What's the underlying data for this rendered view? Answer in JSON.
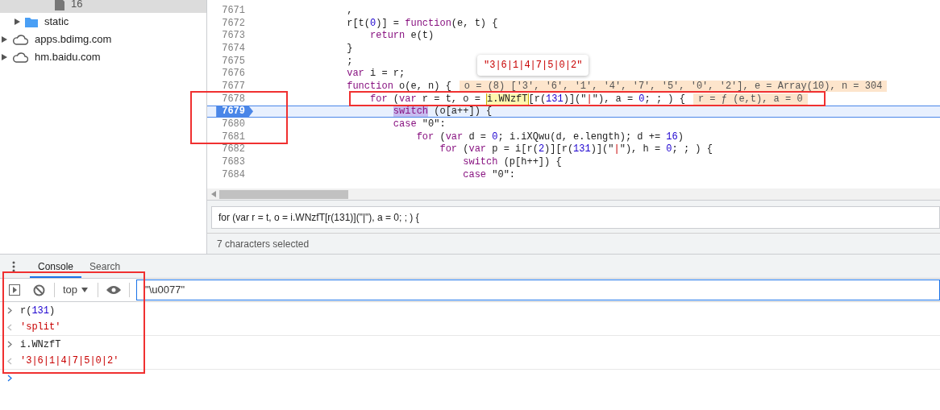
{
  "sidebar": {
    "tree": [
      {
        "kind": "group",
        "children": [
          {
            "kind": "group",
            "children": [
              {
                "label": "16",
                "kind": "file",
                "selected": true
              }
            ]
          },
          {
            "label": "static",
            "kind": "folder",
            "expanded": false,
            "selected": false
          }
        ]
      },
      {
        "label": "apps.bdimg.com",
        "kind": "domain",
        "expanded": false,
        "selected": false
      },
      {
        "label": "hm.baidu.com",
        "kind": "domain",
        "expanded": false,
        "selected": false
      }
    ]
  },
  "editor": {
    "lines": [
      {
        "number": "7671",
        "current": false,
        "tokens": [
          {
            "text": "                ,",
            "kind": "plain"
          }
        ]
      },
      {
        "number": "7672",
        "current": false,
        "tokens": [
          {
            "text": "                r[t(",
            "kind": "plain"
          },
          {
            "text": "0",
            "kind": "num"
          },
          {
            "text": ")] = ",
            "kind": "plain"
          },
          {
            "text": "function",
            "kind": "kw"
          },
          {
            "text": "(e, t) {",
            "kind": "plain"
          }
        ]
      },
      {
        "number": "7673",
        "current": false,
        "tokens": [
          {
            "text": "                    return",
            "kind": "kw"
          },
          {
            "text": " e(t)",
            "kind": "plain"
          }
        ]
      },
      {
        "number": "7674",
        "current": false,
        "tokens": [
          {
            "text": "                }",
            "kind": "plain"
          }
        ]
      },
      {
        "number": "7675",
        "current": false,
        "tokens": [
          {
            "text": "                ;",
            "kind": "plain"
          }
        ]
      },
      {
        "number": "7676",
        "current": false,
        "tokens": [
          {
            "text": "                var",
            "kind": "kw"
          },
          {
            "text": " i = r;",
            "kind": "plain"
          }
        ]
      },
      {
        "number": "7677",
        "current": false,
        "tokens": [
          {
            "text": "                function",
            "kind": "kw"
          },
          {
            "text": " o(e, n) {",
            "kind": "plain"
          }
        ],
        "inline_value": "o = (8) ['3', '6', '1', '4', '7', '5', '0', '2'], e = Array(10), n = 304"
      },
      {
        "number": "7678",
        "current": false,
        "tokens": [
          {
            "text": "                    for",
            "kind": "kw"
          },
          {
            "text": " (",
            "kind": "plain"
          },
          {
            "text": "var",
            "kind": "kw"
          },
          {
            "text": " r = t, o = ",
            "kind": "plain"
          },
          {
            "text": "i.WNzfT",
            "kind": "hover"
          },
          {
            "text": "[r(",
            "kind": "plain"
          },
          {
            "text": "131",
            "kind": "num"
          },
          {
            "text": ")](\"",
            "kind": "plain"
          },
          {
            "text": "|",
            "kind": "str"
          },
          {
            "text": "\"), a = ",
            "kind": "plain"
          },
          {
            "text": "0",
            "kind": "num"
          },
          {
            "text": "; ; ) {",
            "kind": "plain"
          }
        ],
        "inline_value": "r = ƒ (e,t), a = 0"
      },
      {
        "number": "7679",
        "current": true,
        "tokens": [
          {
            "text": "                        switch",
            "kind": "match"
          },
          {
            "text": " (o[a++]) {",
            "kind": "plain"
          }
        ]
      },
      {
        "number": "7680",
        "current": false,
        "tokens": [
          {
            "text": "                        case",
            "kind": "kw"
          },
          {
            "text": " \"0\":",
            "kind": "plain"
          }
        ]
      },
      {
        "number": "7681",
        "current": false,
        "tokens": [
          {
            "text": "                            for",
            "kind": "kw"
          },
          {
            "text": " (",
            "kind": "plain"
          },
          {
            "text": "var",
            "kind": "kw"
          },
          {
            "text": " d = ",
            "kind": "plain"
          },
          {
            "text": "0",
            "kind": "num"
          },
          {
            "text": "; i.iXQwu(d, e.length); d += ",
            "kind": "plain"
          },
          {
            "text": "16",
            "kind": "num"
          },
          {
            "text": ")",
            "kind": "plain"
          }
        ]
      },
      {
        "number": "7682",
        "current": false,
        "tokens": [
          {
            "text": "                                for",
            "kind": "kw"
          },
          {
            "text": " (",
            "kind": "plain"
          },
          {
            "text": "var",
            "kind": "kw"
          },
          {
            "text": " p = i[r(",
            "kind": "plain"
          },
          {
            "text": "2",
            "kind": "num"
          },
          {
            "text": ")][r(",
            "kind": "plain"
          },
          {
            "text": "131",
            "kind": "num"
          },
          {
            "text": ")](\"",
            "kind": "plain"
          },
          {
            "text": "|",
            "kind": "str"
          },
          {
            "text": "\"), h = ",
            "kind": "plain"
          },
          {
            "text": "0",
            "kind": "num"
          },
          {
            "text": "; ; ) {",
            "kind": "plain"
          }
        ]
      },
      {
        "number": "7683",
        "current": false,
        "tokens": [
          {
            "text": "                                    switch",
            "kind": "kw"
          },
          {
            "text": " (p[h++]) {",
            "kind": "plain"
          }
        ]
      },
      {
        "number": "7684",
        "current": false,
        "tokens": [
          {
            "text": "                                    case",
            "kind": "kw"
          },
          {
            "text": " \"0\":",
            "kind": "plain"
          }
        ]
      }
    ],
    "popup": "\"3|6|1|4|7|5|0|2\"",
    "selection_text": "for (var r = t, o = i.WNzfT[r(131)](\"|\"), a = 0; ; ) {",
    "status": "7 characters selected"
  },
  "drawer": {
    "tabs": [
      {
        "label": "Console",
        "selected": true
      },
      {
        "label": "Search",
        "selected": false
      }
    ],
    "toolbar": {
      "context": "top",
      "filter": "\"\\u0077\""
    },
    "entries": [
      {
        "kind": "input",
        "tokens": [
          {
            "text": "r(",
            "kind": "plain"
          },
          {
            "text": "131",
            "kind": "num"
          },
          {
            "text": ")",
            "kind": "plain"
          }
        ]
      },
      {
        "kind": "output",
        "tokens": [
          {
            "text": "'split'",
            "kind": "str"
          }
        ]
      },
      {
        "kind": "input",
        "tokens": [
          {
            "text": "i.WNzfT",
            "kind": "plain"
          }
        ]
      },
      {
        "kind": "output",
        "tokens": [
          {
            "text": "'3|6|1|4|7|5|0|2'",
            "kind": "str"
          }
        ]
      }
    ]
  }
}
